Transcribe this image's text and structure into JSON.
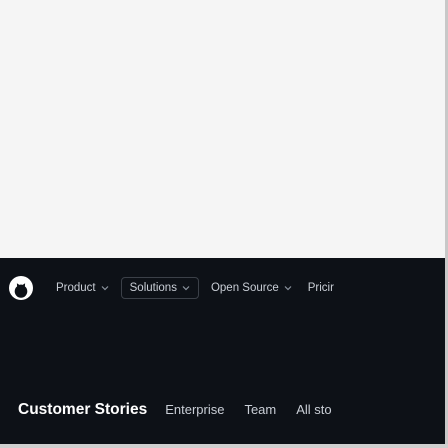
{
  "header": {
    "logo_icon": "github-icon",
    "background": "#0d1117",
    "nav": [
      {
        "label": "Product",
        "has_dropdown": true
      },
      {
        "label": "Solutions",
        "has_dropdown": true
      },
      {
        "label": "Open Source",
        "has_dropdown": true
      },
      {
        "label": "Pricir",
        "has_dropdown": false
      }
    ]
  },
  "subnav": {
    "title": "Customer Stories",
    "links": [
      "Enterprise",
      "Team",
      "All sto"
    ]
  }
}
